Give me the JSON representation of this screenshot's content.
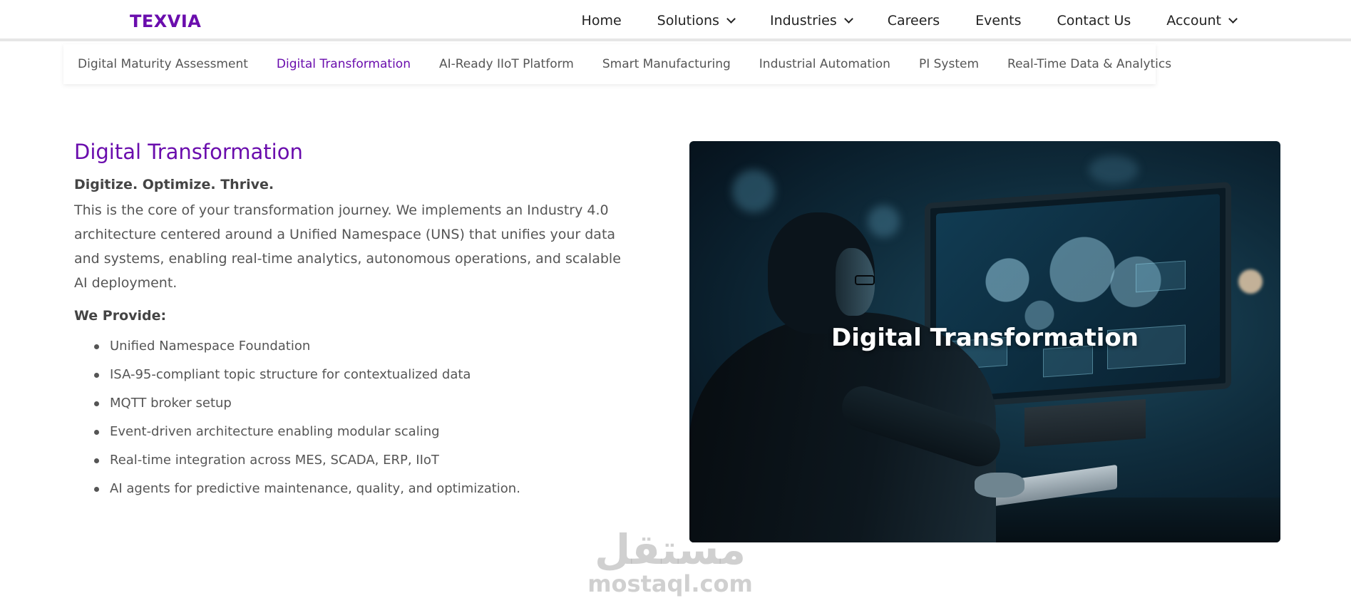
{
  "brand": {
    "logo_text": "TEXVIA",
    "accent_color": "#6a0dad"
  },
  "nav": {
    "items": [
      {
        "label": "Home"
      },
      {
        "label": "Solutions"
      },
      {
        "label": "Industries"
      },
      {
        "label": "Careers"
      },
      {
        "label": "Events"
      },
      {
        "label": "Contact Us"
      },
      {
        "label": "Account"
      }
    ]
  },
  "subnav": {
    "items": [
      {
        "label": "Digital Maturity Assessment"
      },
      {
        "label": "Digital Transformation",
        "active": true
      },
      {
        "label": "AI-Ready IIoT Platform"
      },
      {
        "label": "Smart Manufacturing"
      },
      {
        "label": "Industrial Automation"
      },
      {
        "label": "PI System"
      },
      {
        "label": "Real-Time Data & Analytics"
      }
    ]
  },
  "main": {
    "title": "Digital Transformation",
    "tagline": "Digitize. Optimize. Thrive.",
    "description": "This is the core of your transformation journey. We implements an Industry 4.0 architecture centered around a Unified Namespace (UNS) that unifies your data and systems, enabling real-time analytics, autonomous operations, and scalable AI deployment.",
    "provide_heading": "We Provide:",
    "provide_list": [
      "Unified Namespace Foundation",
      "ISA-95-compliant topic structure for contextualized data",
      "MQTT broker setup",
      "Event-driven architecture enabling modular scaling",
      "Real-time integration across MES, SCADA, ERP, IIoT",
      "AI agents for predictive maintenance, quality, and optimization."
    ]
  },
  "hero": {
    "overlay_title": "Digital Transformation"
  },
  "watermark": {
    "arabic": "مستقل",
    "latin": "mostaql.com"
  }
}
